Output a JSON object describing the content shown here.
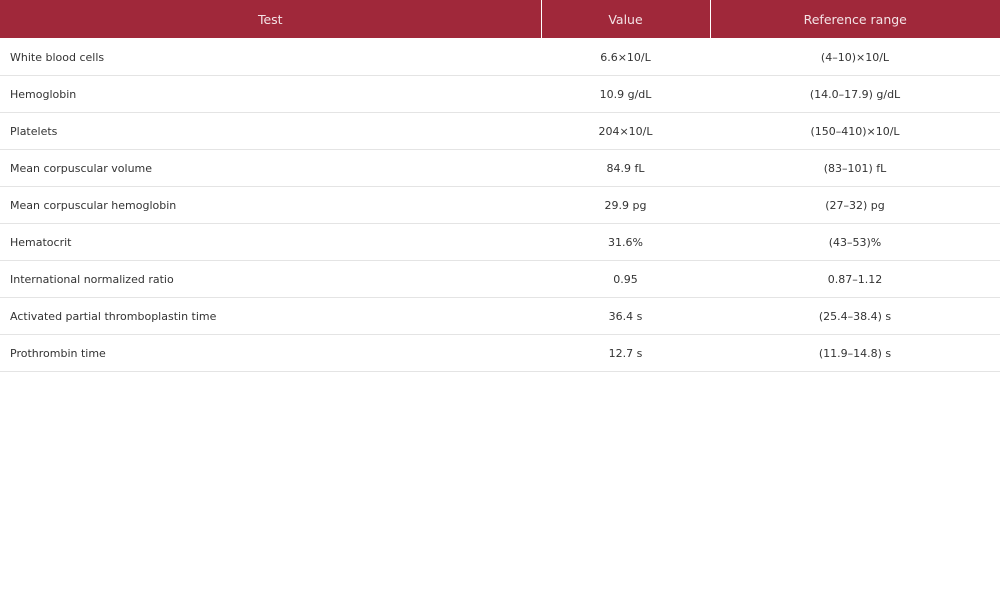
{
  "table": {
    "headers": {
      "test": "Test",
      "value": "Value",
      "reference": "Reference range"
    },
    "rows": [
      {
        "test": "White blood cells",
        "value": "6.6×10/L",
        "reference": "(4–10)×10/L"
      },
      {
        "test": "Hemoglobin",
        "value": "10.9 g/dL",
        "reference": "(14.0–17.9) g/dL"
      },
      {
        "test": "Platelets",
        "value": "204×10/L",
        "reference": "(150–410)×10/L"
      },
      {
        "test": "Mean corpuscular volume",
        "value": "84.9 fL",
        "reference": "(83–101) fL"
      },
      {
        "test": "Mean corpuscular hemoglobin",
        "value": "29.9 pg",
        "reference": "(27–32) pg"
      },
      {
        "test": "Hematocrit",
        "value": "31.6%",
        "reference": "(43–53)%"
      },
      {
        "test": "International normalized ratio",
        "value": "0.95",
        "reference": "0.87–1.12"
      },
      {
        "test": "Activated partial thromboplastin time",
        "value": "36.4 s",
        "reference": "(25.4–38.4) s"
      },
      {
        "test": "Prothrombin time",
        "value": "12.7 s",
        "reference": "(11.9–14.8) s"
      }
    ]
  }
}
